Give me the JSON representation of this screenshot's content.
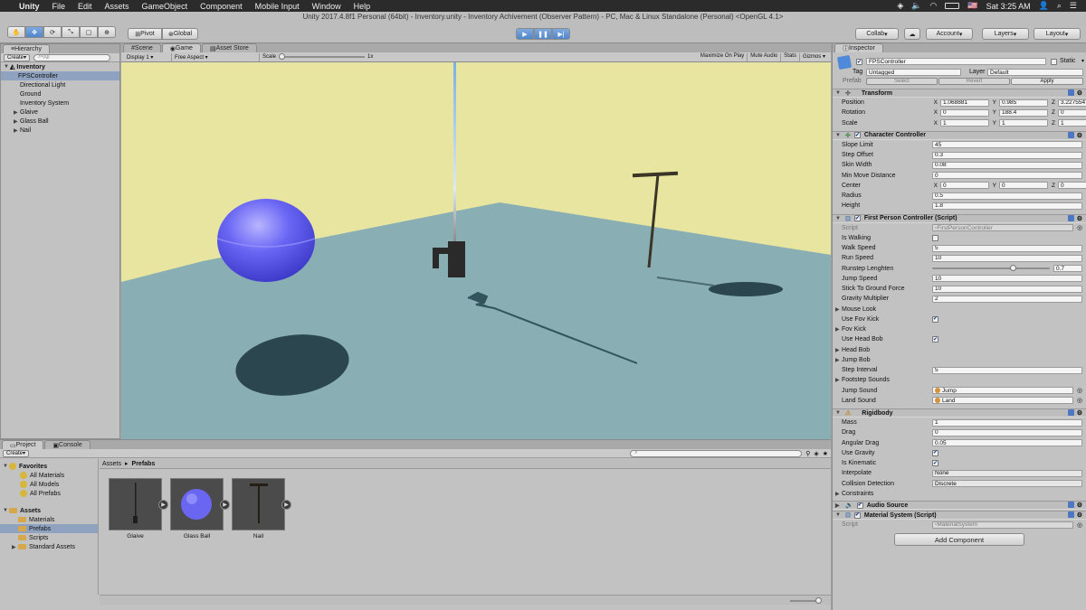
{
  "menubar": {
    "apple": "",
    "items": [
      "Unity",
      "File",
      "Edit",
      "Assets",
      "GameObject",
      "Component",
      "Mobile Input",
      "Window",
      "Help"
    ],
    "status": {
      "battery_icon": "battery-icon",
      "flag": "🇺🇸",
      "time": "Sat 3:25 AM"
    }
  },
  "toolbar": {
    "window_title": "Unity 2017.4.8f1 Personal (64bit) - Inventory.unity - Inventory Achivement (Observer Pattern) - PC, Mac & Linux Standalone (Personal) <OpenGL 4.1>",
    "pivot": "Pivot",
    "global": "Global",
    "collab": "Collab",
    "account": "Account",
    "layers": "Layers",
    "layout": "Layout"
  },
  "hierarchy": {
    "tab": "Hierarchy",
    "create": "Create",
    "search_placeholder": "All",
    "scene": "Inventory",
    "items": [
      "FPSController",
      "Directional Light",
      "Ground",
      "Inventory System",
      "Glaive",
      "Glass Ball",
      "Nail"
    ]
  },
  "game": {
    "tabs": [
      "Scene",
      "Game",
      "Asset Store"
    ],
    "display": "Display 1",
    "aspect": "Free Aspect",
    "scale_label": "Scale",
    "scale_value": "1x",
    "options": [
      "Maximize On Play",
      "Mute Audio",
      "Stats",
      "Gizmos"
    ],
    "colors": {
      "sky": "#e8e5a0",
      "ground": "#89aeb3",
      "sphere": "#6a66f2",
      "shadow": "#2c4650"
    }
  },
  "project": {
    "tabs": [
      "Project",
      "Console"
    ],
    "create": "Create",
    "favorites": "Favorites",
    "favorite_items": [
      "All Materials",
      "All Models",
      "All Prefabs"
    ],
    "assets": "Assets",
    "asset_folders": [
      "Materials",
      "Prefabs",
      "Scripts",
      "Standard Assets"
    ],
    "breadcrumb": [
      "Assets",
      "Prefabs"
    ],
    "prefabs": [
      "Glaive",
      "Glass Ball",
      "Nail"
    ]
  },
  "inspector": {
    "tab": "Inspector",
    "object_name": "FPSController",
    "static_label": "Static",
    "tag_label": "Tag",
    "tag_value": "Untagged",
    "layer_label": "Layer",
    "layer_value": "Default",
    "prefab_label": "Prefab",
    "prefab_buttons": [
      "Select",
      "Revert",
      "Apply"
    ],
    "transform": {
      "title": "Transform",
      "position_label": "Position",
      "position": [
        "1.068881",
        "0.985",
        "3.227554"
      ],
      "rotation_label": "Rotation",
      "rotation": [
        "0",
        "188.4",
        "0"
      ],
      "scale_label": "Scale",
      "scale": [
        "1",
        "1",
        "1"
      ]
    },
    "character_controller": {
      "title": "Character Controller",
      "slope_limit": {
        "label": "Slope Limit",
        "value": "45"
      },
      "step_offset": {
        "label": "Step Offset",
        "value": "0.3"
      },
      "skin_width": {
        "label": "Skin Width",
        "value": "0.08"
      },
      "min_move": {
        "label": "Min Move Distance",
        "value": "0"
      },
      "center_label": "Center",
      "center": [
        "0",
        "0",
        "0"
      ],
      "radius": {
        "label": "Radius",
        "value": "0.5"
      },
      "height": {
        "label": "Height",
        "value": "1.8"
      }
    },
    "fpc": {
      "title": "First Person Controller (Script)",
      "script_label": "Script",
      "script_value": "FirstPersonController",
      "is_walking": "Is Walking",
      "walk_speed": {
        "label": "Walk Speed",
        "value": "5"
      },
      "run_speed": {
        "label": "Run Speed",
        "value": "10"
      },
      "runstep": {
        "label": "Runstep Lenghten",
        "value": "0.7",
        "fraction": 0.7
      },
      "jump_speed": {
        "label": "Jump Speed",
        "value": "10"
      },
      "stick": {
        "label": "Stick To Ground Force",
        "value": "10"
      },
      "gravity": {
        "label": "Gravity Multiplier",
        "value": "2"
      },
      "mouse_look": "Mouse Look",
      "use_fov_kick": "Use Fov Kick",
      "fov_kick": "Fov Kick",
      "use_head_bob": "Use Head Bob",
      "head_bob": "Head Bob",
      "jump_bob": "Jump Bob",
      "step_interval": {
        "label": "Step Interval",
        "value": "5"
      },
      "footstep": "Footstep Sounds",
      "jump_sound": {
        "label": "Jump Sound",
        "value": "Jump"
      },
      "land_sound": {
        "label": "Land Sound",
        "value": "Land"
      }
    },
    "rigidbody": {
      "title": "Rigidbody",
      "mass": {
        "label": "Mass",
        "value": "1"
      },
      "drag": {
        "label": "Drag",
        "value": "0"
      },
      "angular_drag": {
        "label": "Angular Drag",
        "value": "0.05"
      },
      "use_gravity": "Use Gravity",
      "is_kinematic": "Is Kinematic",
      "interpolate": {
        "label": "Interpolate",
        "value": "None"
      },
      "collision": {
        "label": "Collision Detection",
        "value": "Discrete"
      },
      "constraints": "Constraints"
    },
    "audio_source": {
      "title": "Audio Source"
    },
    "material_system": {
      "title": "Material System (Script)",
      "script_label": "Script",
      "script_value": "MaterialSystem"
    },
    "add_component": "Add Component"
  }
}
